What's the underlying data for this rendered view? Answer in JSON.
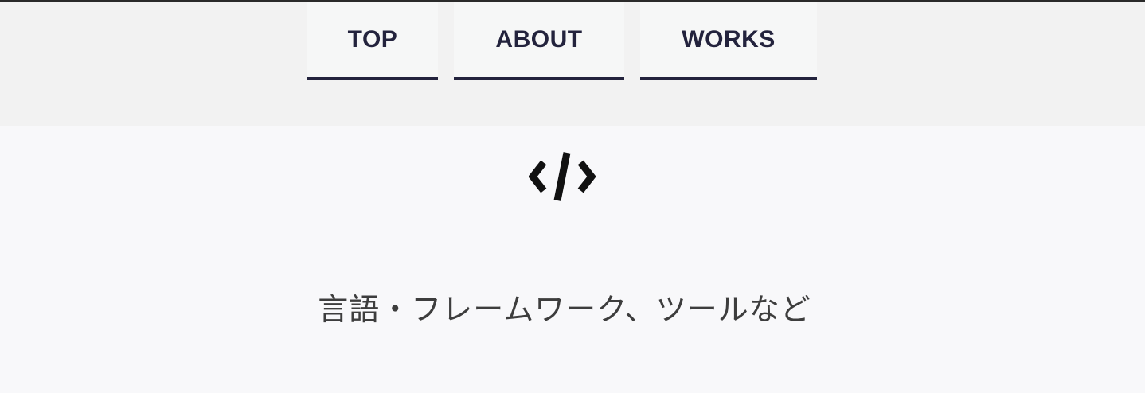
{
  "nav": {
    "items": [
      {
        "label": "TOP"
      },
      {
        "label": "ABOUT"
      },
      {
        "label": "WORKS"
      }
    ]
  },
  "section": {
    "icon": "code-icon",
    "title": "言語・フレームワーク、ツールなど"
  },
  "colors": {
    "nav_text": "#23233d",
    "nav_underline": "#23233d",
    "header_bg": "#f2f2f2",
    "page_bg": "#f8f8fa",
    "title_text": "#3d3d3d"
  }
}
